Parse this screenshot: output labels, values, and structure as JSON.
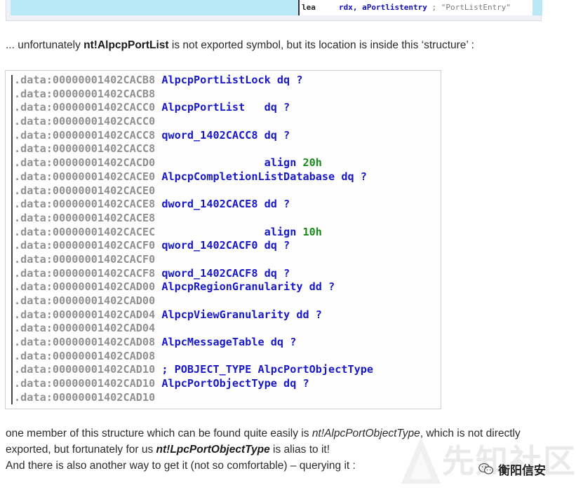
{
  "top_code": {
    "mnemonic": "lea",
    "operands": "rdx, aPortlistentry",
    "comment": "; \"PortListEntry\""
  },
  "intro": {
    "prefix": "... unfortunately ",
    "symbol": "nt!AlpcpPortList",
    "suffix": " is not exported symbol, but its location is inside this ‘structure’ :"
  },
  "code_lines": [
    {
      "addr": ".data:00000001402CACB8",
      "rest": " AlpcpPortListLock dq ?"
    },
    {
      "addr": ".data:00000001402CACB8",
      "rest": ""
    },
    {
      "addr": ".data:00000001402CACC0",
      "rest": " AlpcpPortList   dq ?"
    },
    {
      "addr": ".data:00000001402CACC0",
      "rest": ""
    },
    {
      "addr": ".data:00000001402CACC8",
      "rest": " qword_1402CACC8 dq ?"
    },
    {
      "addr": ".data:00000001402CACC8",
      "rest": ""
    },
    {
      "addr": ".data:00000001402CACD0",
      "rest": "                 align ",
      "num": "20h"
    },
    {
      "addr": ".data:00000001402CACE0",
      "rest": " AlpcpCompletionListDatabase dq ?"
    },
    {
      "addr": ".data:00000001402CACE0",
      "rest": ""
    },
    {
      "addr": ".data:00000001402CACE8",
      "rest": " dword_1402CACE8 dd ?"
    },
    {
      "addr": ".data:00000001402CACE8",
      "rest": ""
    },
    {
      "addr": ".data:00000001402CACEC",
      "rest": "                 align ",
      "num": "10h"
    },
    {
      "addr": ".data:00000001402CACF0",
      "rest": " qword_1402CACF0 dq ?"
    },
    {
      "addr": ".data:00000001402CACF0",
      "rest": ""
    },
    {
      "addr": ".data:00000001402CACF8",
      "rest": " qword_1402CACF8 dq ?"
    },
    {
      "addr": ".data:00000001402CAD00",
      "rest": " AlpcpRegionGranularity dd ?"
    },
    {
      "addr": ".data:00000001402CAD00",
      "rest": ""
    },
    {
      "addr": ".data:00000001402CAD04",
      "rest": " AlpcpViewGranularity dd ?"
    },
    {
      "addr": ".data:00000001402CAD04",
      "rest": ""
    },
    {
      "addr": ".data:00000001402CAD08",
      "rest": " AlpcMessageTable dq ?"
    },
    {
      "addr": ".data:00000001402CAD08",
      "rest": ""
    },
    {
      "addr": ".data:00000001402CAD10",
      "rest": " ; POBJECT_TYPE AlpcPortObjectType"
    },
    {
      "addr": ".data:00000001402CAD10",
      "rest": " AlpcPortObjectType dq ?"
    },
    {
      "addr": ".data:00000001402CAD10",
      "rest": ""
    }
  ],
  "para2": {
    "line1_prefix": "one member of this structure which can be found quite easily is ",
    "line1_symbol": "nt!AlpcPortObjectType",
    "line1_suffix": ", which is not directly",
    "line2_prefix": "exported, but fortunately for us ",
    "line2_symbol": "nt!LpcPortObjectType",
    "line2_suffix": " is alias to it!",
    "line3": "And there is also another way to get it (not so comfortable) – querying it :"
  },
  "watermark": {
    "bg_text": "先知社区",
    "label": "衡阳信安"
  }
}
